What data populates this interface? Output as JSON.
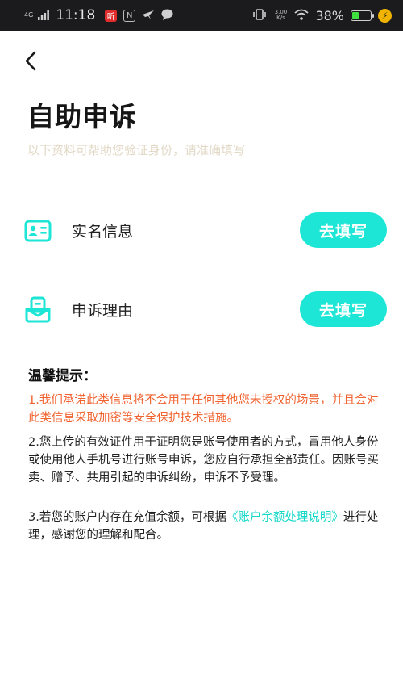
{
  "status_bar": {
    "carrier": "4G",
    "time": "11:18",
    "app_icons": [
      "听",
      "N"
    ],
    "net_speed": "3.00 K/s",
    "battery_percent": "38%",
    "battery_level": 0.38,
    "battery_color": "#3fe03f"
  },
  "page": {
    "title": "自助申诉",
    "subtitle": "以下资料可帮助您验证身份，请准确填写"
  },
  "rows": [
    {
      "label": "实名信息",
      "button": "去填写",
      "icon": "id-card-icon"
    },
    {
      "label": "申诉理由",
      "button": "去填写",
      "icon": "appeal-document-icon"
    }
  ],
  "tips": {
    "title": "温馨提示：",
    "item1": "1.我们承诺此类信息将不会用于任何其他您未授权的场景，并且会对此类信息采取加密等安全保护技术措施。",
    "item2": "2.您上传的有效证件用于证明您是账号使用者的方式，冒用他人身份或使用他人手机号进行账号申诉，您应自行承担全部责任。因账号买卖、赠予、共用引起的申诉纠纷，申诉不予受理。",
    "item3_prefix": "3.若您的账户内存在充值余额，可根据",
    "item3_link": "《账户余额处理说明》",
    "item3_suffix": "进行处理，感谢您的理解和配合。"
  },
  "colors": {
    "accent": "#1de6d6",
    "warning": "#f0622f",
    "link": "#13d8c8",
    "subtitle": "#e2d8c6"
  }
}
